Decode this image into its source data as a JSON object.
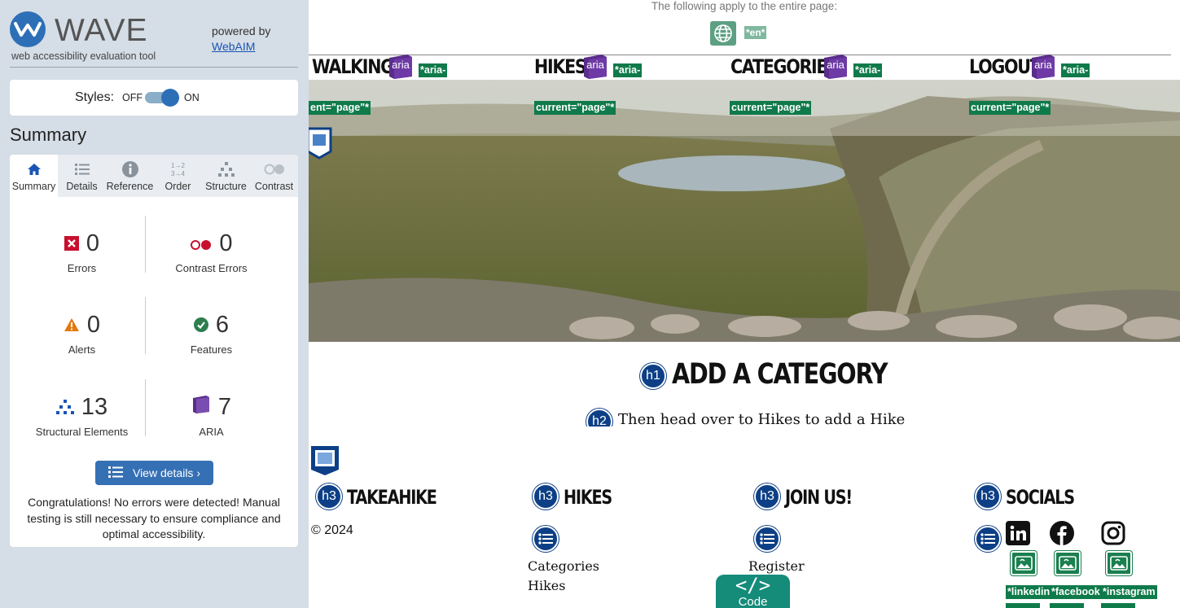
{
  "sidebar": {
    "brand": "WAVE",
    "tagline": "web accessibility evaluation tool",
    "powered_by": "powered by",
    "powered_link": "WebAIM",
    "styles_label": "Styles:",
    "styles_off": "OFF",
    "styles_on": "ON",
    "summary_title": "Summary",
    "tabs": [
      {
        "label": "Summary",
        "icon": "home-icon",
        "active": true
      },
      {
        "label": "Details",
        "icon": "list-icon"
      },
      {
        "label": "Reference",
        "icon": "info-icon"
      },
      {
        "label": "Order",
        "icon": "order-icon"
      },
      {
        "label": "Structure",
        "icon": "structure-icon"
      },
      {
        "label": "Contrast",
        "icon": "contrast-icon"
      }
    ],
    "stats": {
      "errors": {
        "count": "0",
        "label": "Errors"
      },
      "contrast_errors": {
        "count": "0",
        "label": "Contrast Errors"
      },
      "alerts": {
        "count": "0",
        "label": "Alerts"
      },
      "features": {
        "count": "6",
        "label": "Features"
      },
      "structural": {
        "count": "13",
        "label": "Structural Elements"
      },
      "aria": {
        "count": "7",
        "label": "ARIA"
      }
    },
    "view_details": "View details ›",
    "congrats": "Congratulations! No errors were detected! Manual testing is still necessary to ensure compliance and optimal accessibility."
  },
  "page": {
    "applies_text": "The following apply to the entire page:",
    "lang_tag": "*en*",
    "nav": [
      {
        "label": "WALKING!",
        "aria_tag": "*aria-",
        "current_tag": "ent=\"page\"*"
      },
      {
        "label": "HIKES",
        "aria_tag": "*aria-",
        "current_tag": "current=\"page\"*"
      },
      {
        "label": "CATEGORIES",
        "aria_tag": "*aria-",
        "current_tag": "current=\"page\"*"
      },
      {
        "label": "LOGOUT",
        "aria_tag": "*aria-",
        "current_tag": "current=\"page\"*"
      }
    ],
    "aria_badge_label": "aria",
    "h1_badge": "h1",
    "h1_text": "ADD A CATEGORY",
    "h2_badge": "h2",
    "h2_text": "Then head over to Hikes to add a Hike",
    "h3_badge": "h3",
    "footer": {
      "col1_title": "TAKEAHIKE",
      "copyright": "© 2024",
      "col2_title": "HIKES",
      "col2_links": [
        "Categories",
        "Hikes"
      ],
      "col3_title": "JOIN US!",
      "col3_links": [
        "Register"
      ],
      "col4_title": "SOCIALS",
      "social_tags": [
        "*linkedin",
        "*facebook",
        "*instagram"
      ]
    },
    "code_button": "Code"
  },
  "colors": {
    "wave_blue": "#2d6fb7",
    "error_red": "#c8102e",
    "alert_orange": "#e07a10",
    "feature_green": "#2e7d4f",
    "aria_purple": "#5a2d8c",
    "tag_green": "#0f7a4a"
  }
}
